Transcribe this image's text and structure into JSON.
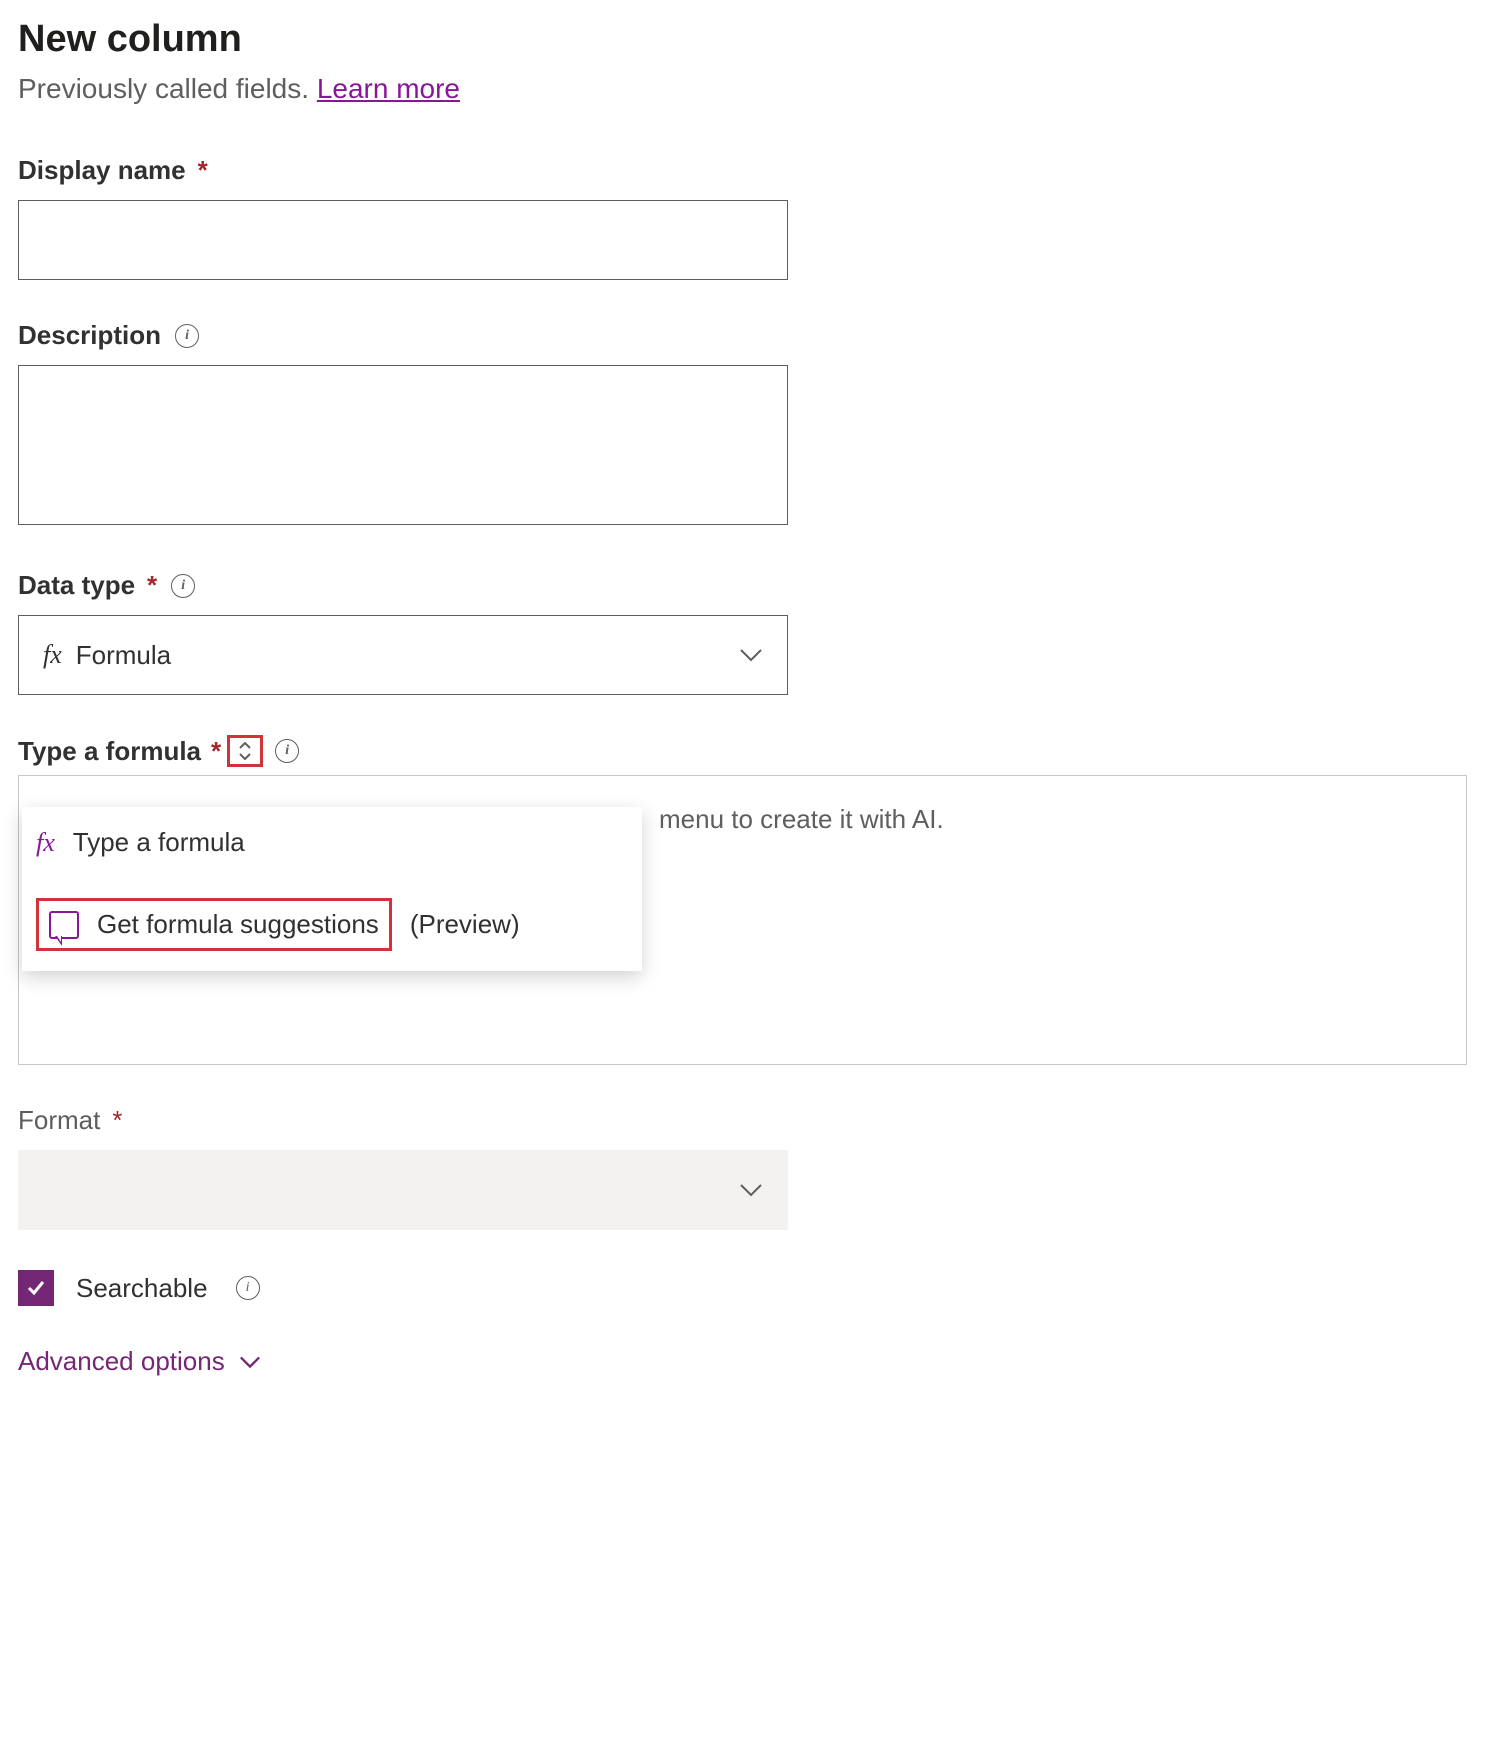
{
  "header": {
    "title": "New column",
    "subtitle_prefix": "Previously called fields. ",
    "learn_more": "Learn more"
  },
  "display_name": {
    "label": "Display name",
    "value": ""
  },
  "description": {
    "label": "Description",
    "value": ""
  },
  "data_type": {
    "label": "Data type",
    "selected": "Formula",
    "fx": "fx"
  },
  "formula": {
    "label": "Type a formula",
    "placeholder_right": "menu to create it with AI.",
    "menu": {
      "type_option": "Type a formula",
      "fx": "fx",
      "suggest_option": "Get formula suggestions",
      "suggest_badge": "(Preview)"
    }
  },
  "format": {
    "label": "Format",
    "selected": ""
  },
  "searchable": {
    "label": "Searchable",
    "checked": true
  },
  "advanced": {
    "label": "Advanced options"
  }
}
